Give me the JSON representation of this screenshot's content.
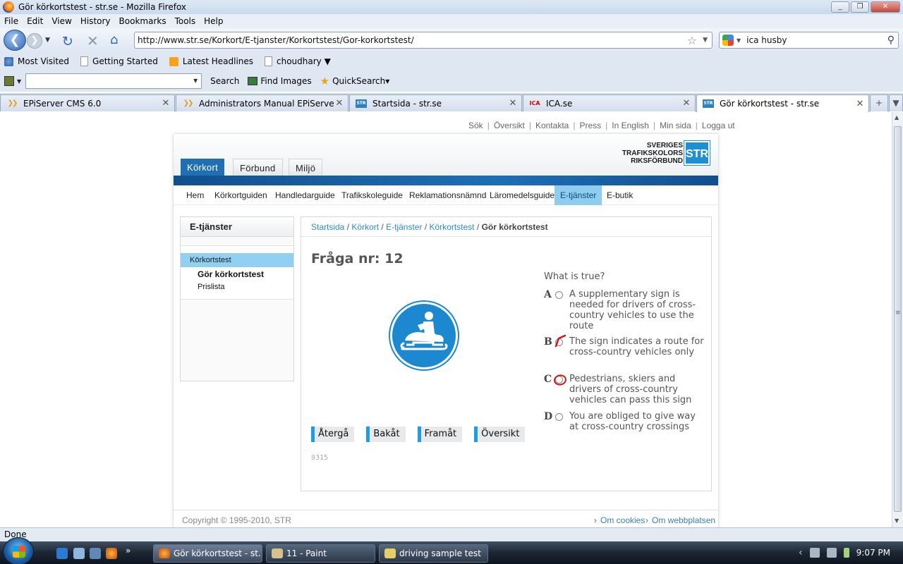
{
  "window": {
    "title": "Gör körkortstest - str.se - Mozilla Firefox",
    "buttons": [
      "_",
      "❐",
      "✕"
    ]
  },
  "menu": [
    "File",
    "Edit",
    "View",
    "History",
    "Bookmarks",
    "Tools",
    "Help"
  ],
  "nav": {
    "url": "http://www.str.se/Korkort/E-tjanster/Korkortstest/Gor-korkortstest/",
    "search_value": "ica husby"
  },
  "bookmarks": [
    "Most Visited",
    "Getting Started",
    "Latest Headlines",
    "choudhary ▼"
  ],
  "toolbar2": {
    "search": "Search",
    "find_images": "Find Images",
    "quicksearch": "QuickSearch▾"
  },
  "tabs": [
    {
      "label": "EPiServer CMS 6.0",
      "icon": "episerver-icon"
    },
    {
      "label": "Administrators Manual EPiServer C...",
      "icon": "episerver-icon"
    },
    {
      "label": "Startsida - str.se",
      "icon": "str-icon"
    },
    {
      "label": "ICA.se",
      "icon": "ica-icon"
    },
    {
      "label": "Gör körkortstest - str.se",
      "icon": "str-icon",
      "active": true
    }
  ],
  "page": {
    "toplinks": [
      "Sök",
      "Översikt",
      "Kontakta",
      "Press",
      "In English",
      "Min sida",
      "Logga ut"
    ],
    "main_tabs": [
      "Körkort",
      "Förbund",
      "Miljö"
    ],
    "logo": {
      "line1": "SVERIGES",
      "line2": "TRAFIKSKOLORS",
      "line3": "RIKSFÖRBUND",
      "mark": "STR"
    },
    "subnav": [
      "Hem",
      "Körkortguiden",
      "Handledarguide",
      "Trafikskoleguide",
      "Reklamationsnämnd",
      "Läromedelsguide",
      "E-tjänster",
      "E-butik"
    ],
    "sidebar": {
      "title": "E-tjänster",
      "selected": "Körkortstest",
      "sub_active": "Gör körkortstest",
      "sub": "Prislista"
    },
    "breadcrumb": {
      "items": [
        "Startsida",
        "Körkort",
        "E-tjänster",
        "Körkortstest"
      ],
      "current": "Gör körkortstest",
      "sep": "/"
    },
    "question": {
      "heading": "Fråga nr: 12",
      "prompt": "What is true?",
      "options": [
        {
          "letter": "A",
          "text": "A supplementary sign is needed for drivers of cross-country vehicles to use the route"
        },
        {
          "letter": "B",
          "text": "The sign indicates a route for cross-country vehicles only"
        },
        {
          "letter": "C",
          "text": "Pedestrians, skiers and drivers of cross-country vehicles can pass this sign"
        },
        {
          "letter": "D",
          "text": "You are obliged to give way at cross-country crossings"
        }
      ]
    },
    "buttons": [
      "Återgå",
      "Bakåt",
      "Framåt",
      "Översikt"
    ],
    "code": "9315",
    "footer": {
      "copyright": "Copyright © 1995-2010, STR",
      "links": [
        "Om cookies",
        "Om webbplatsen"
      ]
    }
  },
  "status": "Done",
  "taskbar": {
    "tasks": [
      "Gör körkortstest - st...",
      "11 - Paint",
      "driving sample test"
    ],
    "clock": "9:07 PM"
  }
}
